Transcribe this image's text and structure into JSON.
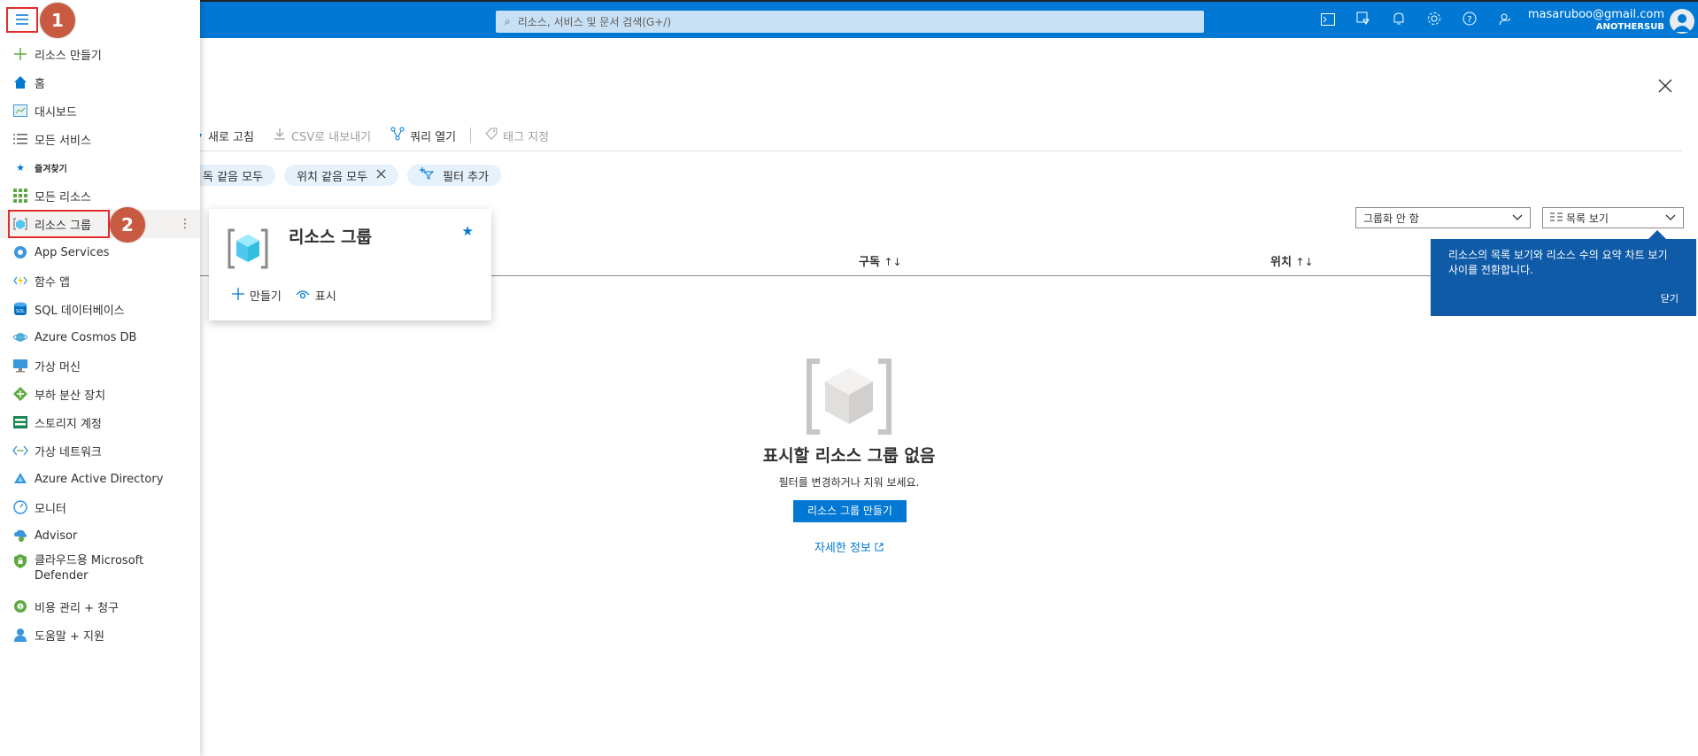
{
  "topbar": {
    "search_placeholder": "리소스, 서비스 및 문서 검색(G+/)",
    "icons": [
      "cloud-shell-icon",
      "directory-filter-icon",
      "notifications-icon",
      "settings-icon",
      "help-icon",
      "feedback-icon"
    ],
    "account_email": "masaruboo@gmail.com",
    "account_tenant": "ANOTHERSUB"
  },
  "annotations": {
    "badge1": "1",
    "badge2": "2"
  },
  "sidebar": {
    "items": [
      {
        "label": "리소스 만들기",
        "icon": "plus-icon"
      },
      {
        "label": "홈",
        "icon": "home-icon"
      },
      {
        "label": "대시보드",
        "icon": "dashboard-icon"
      },
      {
        "label": "모든 서비스",
        "icon": "list-icon"
      },
      {
        "label": "즐겨찾기",
        "icon": "star-icon"
      },
      {
        "label": "모든 리소스",
        "icon": "grid-icon"
      },
      {
        "label": "리소스 그룹",
        "icon": "resource-group-icon"
      },
      {
        "label": "App Services",
        "icon": "app-services-icon"
      },
      {
        "label": "함수 앱",
        "icon": "function-app-icon"
      },
      {
        "label": "SQL 데이터베이스",
        "icon": "sql-database-icon"
      },
      {
        "label": "Azure Cosmos DB",
        "icon": "cosmos-db-icon"
      },
      {
        "label": "가상 머신",
        "icon": "virtual-machine-icon"
      },
      {
        "label": "부하 분산 장치",
        "icon": "load-balancer-icon"
      },
      {
        "label": "스토리지 계정",
        "icon": "storage-account-icon"
      },
      {
        "label": "가상 네트워크",
        "icon": "virtual-network-icon"
      },
      {
        "label": "Azure Active Directory",
        "icon": "active-directory-icon"
      },
      {
        "label": "모니터",
        "icon": "monitor-icon"
      },
      {
        "label": "Advisor",
        "icon": "advisor-icon"
      },
      {
        "label": "클라우드용 Microsoft Defender",
        "icon": "defender-icon"
      },
      {
        "label": "비용 관리 + 청구",
        "icon": "cost-management-icon"
      },
      {
        "label": "도움말 + 지원",
        "icon": "help-support-icon"
      }
    ]
  },
  "toolbar": {
    "refresh": "새로 고침",
    "export_csv": "CSV로 내보내기",
    "open_query": "쿼리 열기",
    "assign_tags": "태그 지정"
  },
  "filters": {
    "subscription_pill": "독 같음 모두",
    "location_pill": "위치 같음 모두",
    "add_filter": "필터 추가"
  },
  "view": {
    "grouping_select": "그룹화 안 함",
    "view_select": "목록 보기"
  },
  "tooltip": {
    "text": "리소스의 목록 보기와 리소스 수의 요약 차트 보기 사이를 전환합니다.",
    "close": "닫기"
  },
  "table": {
    "col_subscription": "구독",
    "col_location": "위치"
  },
  "card": {
    "title": "리소스 그룹",
    "create": "만들기",
    "show": "표시"
  },
  "empty": {
    "title": "표시할 리소스 그룹 없음",
    "subtitle": "필터를 변경하거나 지워 보세요.",
    "create_button": "리소스 그룹 만들기",
    "learn_more": "자세한 정보"
  }
}
